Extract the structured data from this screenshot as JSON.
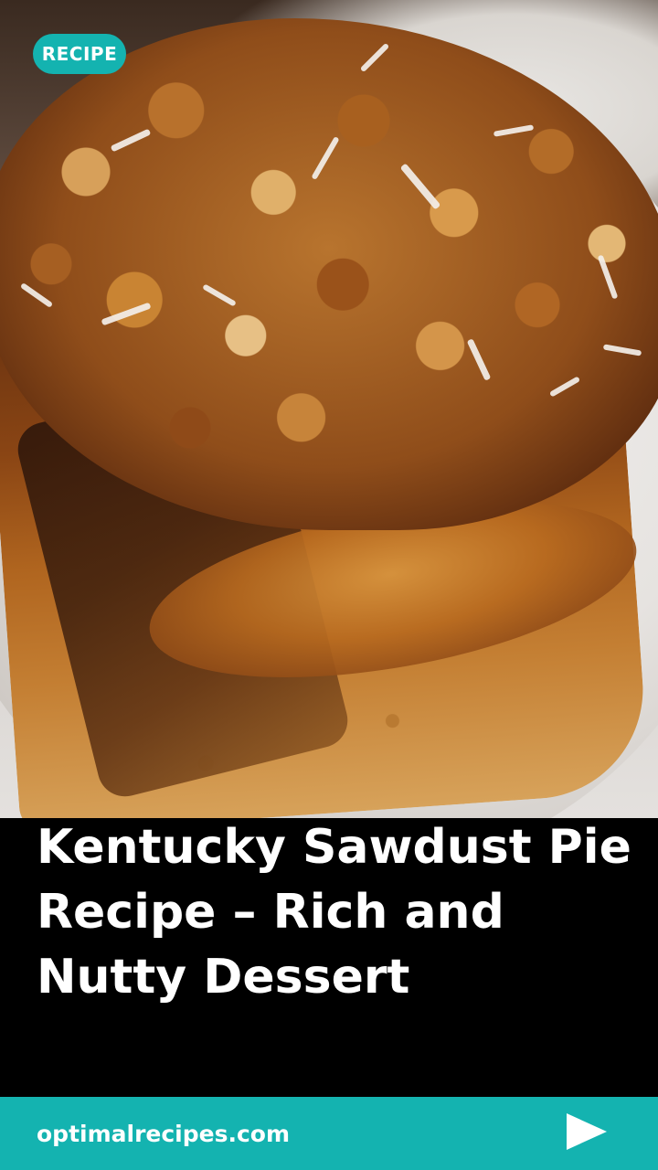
{
  "badge": {
    "label": "RECIPE",
    "color": "#14b3b0"
  },
  "hero": {
    "alt": "Kentucky Sawdust Pie bar topped with pecans and coconut"
  },
  "title": "Kentucky Sawdust Pie Recipe – Rich and Nutty Dessert",
  "footer": {
    "site": "optimalrecipes.com",
    "next_icon": "play-arrow-icon",
    "color": "#14b3b0"
  }
}
